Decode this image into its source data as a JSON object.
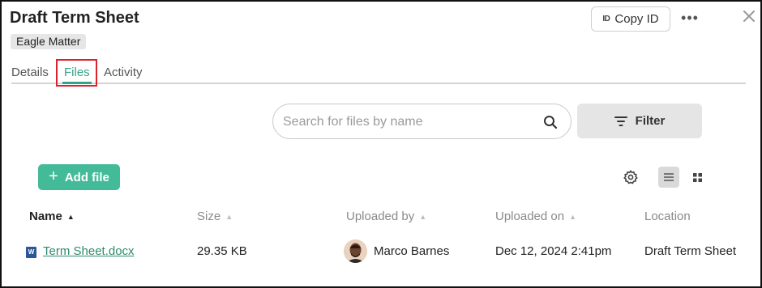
{
  "header": {
    "title": "Draft Term Sheet",
    "matter_badge": "Eagle Matter",
    "copy_id_label": "Copy ID",
    "copy_id_icon_text": "ID",
    "more_label": "•••"
  },
  "tabs": [
    {
      "label": "Details",
      "active": false
    },
    {
      "label": "Files",
      "active": true
    },
    {
      "label": "Activity",
      "active": false
    }
  ],
  "toolbar": {
    "search_placeholder": "Search for files by name",
    "search_value": "",
    "filter_label": "Filter",
    "add_file_label": "Add file",
    "add_file_plus": "+",
    "view_mode": "list"
  },
  "table": {
    "columns": [
      {
        "label": "Name",
        "sorted": true,
        "arrow": "▲"
      },
      {
        "label": "Size",
        "sorted": false,
        "arrow": "▲"
      },
      {
        "label": "Uploaded by",
        "sorted": false,
        "arrow": "▲"
      },
      {
        "label": "Uploaded on",
        "sorted": false,
        "arrow": "▲"
      },
      {
        "label": "Location",
        "sorted": false,
        "arrow": ""
      }
    ],
    "rows": [
      {
        "file_type_icon": "W",
        "name": "Term Sheet.docx",
        "size": "29.35 KB",
        "uploaded_by": "Marco Barnes",
        "uploaded_on": "Dec 12, 2024 2:41pm",
        "location": "Draft Term Sheet"
      }
    ]
  },
  "colors": {
    "accent": "#44bb98",
    "link": "#2e8a6f",
    "highlight": "#d9232e",
    "word_blue": "#2b579a"
  }
}
